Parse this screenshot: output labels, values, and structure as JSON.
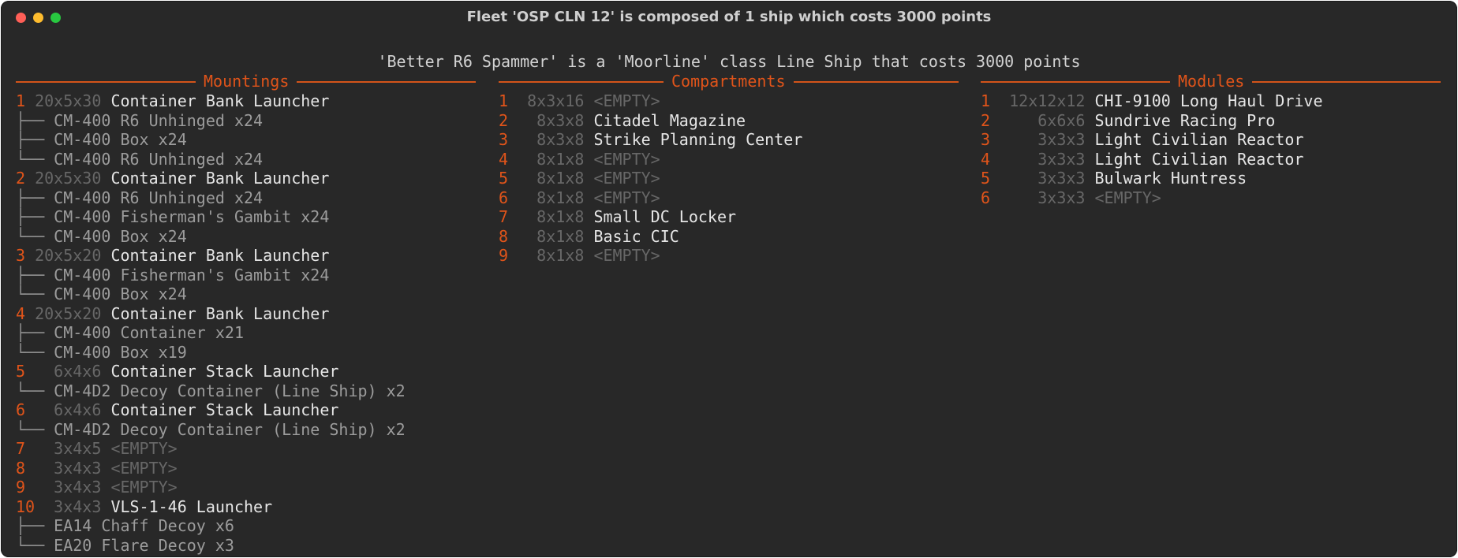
{
  "window": {
    "title": "Fleet 'OSP CLN 12' is composed of 1 ship which costs 3000 points"
  },
  "ship_header": "'Better R6 Spammer' is a 'Moorline' class Line Ship that costs 3000 points",
  "colors": {
    "accent": "#e0541a",
    "bg": "#282828"
  },
  "mountings": {
    "title": "Mountings",
    "rows": [
      {
        "t": "mount",
        "num": "1",
        "size": "20x5x30",
        "name": "Container Bank Launcher"
      },
      {
        "t": "sub",
        "branch": "├──",
        "text": "CM-400 R6 Unhinged x24"
      },
      {
        "t": "sub",
        "branch": "├──",
        "text": "CM-400 Box x24"
      },
      {
        "t": "sub",
        "branch": "└──",
        "text": "CM-400 R6 Unhinged x24"
      },
      {
        "t": "mount",
        "num": "2",
        "size": "20x5x30",
        "name": "Container Bank Launcher"
      },
      {
        "t": "sub",
        "branch": "├──",
        "text": "CM-400 R6 Unhinged x24"
      },
      {
        "t": "sub",
        "branch": "├──",
        "text": "CM-400 Fisherman's Gambit x24"
      },
      {
        "t": "sub",
        "branch": "└──",
        "text": "CM-400 Box x24"
      },
      {
        "t": "mount",
        "num": "3",
        "size": "20x5x20",
        "name": "Container Bank Launcher"
      },
      {
        "t": "sub",
        "branch": "├──",
        "text": "CM-400 Fisherman's Gambit x24"
      },
      {
        "t": "sub",
        "branch": "└──",
        "text": "CM-400 Box x24"
      },
      {
        "t": "mount",
        "num": "4",
        "size": "20x5x20",
        "name": "Container Bank Launcher"
      },
      {
        "t": "sub",
        "branch": "├──",
        "text": "CM-400 Container x21"
      },
      {
        "t": "sub",
        "branch": "└──",
        "text": "CM-400 Box x19"
      },
      {
        "t": "mount",
        "num": "5",
        "size": "  6x4x6",
        "name": "Container Stack Launcher"
      },
      {
        "t": "sub",
        "branch": "└──",
        "text": "CM-4D2 Decoy Container (Line Ship) x2"
      },
      {
        "t": "mount",
        "num": "6",
        "size": "  6x4x6",
        "name": "Container Stack Launcher"
      },
      {
        "t": "sub",
        "branch": "└──",
        "text": "CM-4D2 Decoy Container (Line Ship) x2"
      },
      {
        "t": "mount",
        "num": "7",
        "size": "  3x4x5",
        "name": "<EMPTY>",
        "empty": true
      },
      {
        "t": "mount",
        "num": "8",
        "size": "  3x4x3",
        "name": "<EMPTY>",
        "empty": true
      },
      {
        "t": "mount",
        "num": "9",
        "size": "  3x4x3",
        "name": "<EMPTY>",
        "empty": true
      },
      {
        "t": "mount",
        "num": "10",
        "size": " 3x4x3",
        "name": "VLS-1-46 Launcher"
      },
      {
        "t": "sub",
        "branch": "├──",
        "text": "EA14 Chaff Decoy x6"
      },
      {
        "t": "sub",
        "branch": "└──",
        "text": "EA20 Flare Decoy x3"
      }
    ]
  },
  "compartments": {
    "title": "Compartments",
    "rows": [
      {
        "num": "1",
        "size": "8x3x16",
        "name": "<EMPTY>",
        "empty": true
      },
      {
        "num": "2",
        "size": " 8x3x8",
        "name": "Citadel Magazine"
      },
      {
        "num": "3",
        "size": " 8x3x8",
        "name": "Strike Planning Center"
      },
      {
        "num": "4",
        "size": " 8x1x8",
        "name": "<EMPTY>",
        "empty": true
      },
      {
        "num": "5",
        "size": " 8x1x8",
        "name": "<EMPTY>",
        "empty": true
      },
      {
        "num": "6",
        "size": " 8x1x8",
        "name": "<EMPTY>",
        "empty": true
      },
      {
        "num": "7",
        "size": " 8x1x8",
        "name": "Small DC Locker"
      },
      {
        "num": "8",
        "size": " 8x1x8",
        "name": "Basic CIC"
      },
      {
        "num": "9",
        "size": " 8x1x8",
        "name": "<EMPTY>",
        "empty": true
      }
    ]
  },
  "modules": {
    "title": "Modules",
    "rows": [
      {
        "num": "1",
        "size": "12x12x12",
        "name": "CHI-9100 Long Haul Drive"
      },
      {
        "num": "2",
        "size": "   6x6x6",
        "name": "Sundrive Racing Pro"
      },
      {
        "num": "3",
        "size": "   3x3x3",
        "name": "Light Civilian Reactor"
      },
      {
        "num": "4",
        "size": "   3x3x3",
        "name": "Light Civilian Reactor"
      },
      {
        "num": "5",
        "size": "   3x3x3",
        "name": "Bulwark Huntress"
      },
      {
        "num": "6",
        "size": "   3x3x3",
        "name": "<EMPTY>",
        "empty": true
      }
    ]
  }
}
